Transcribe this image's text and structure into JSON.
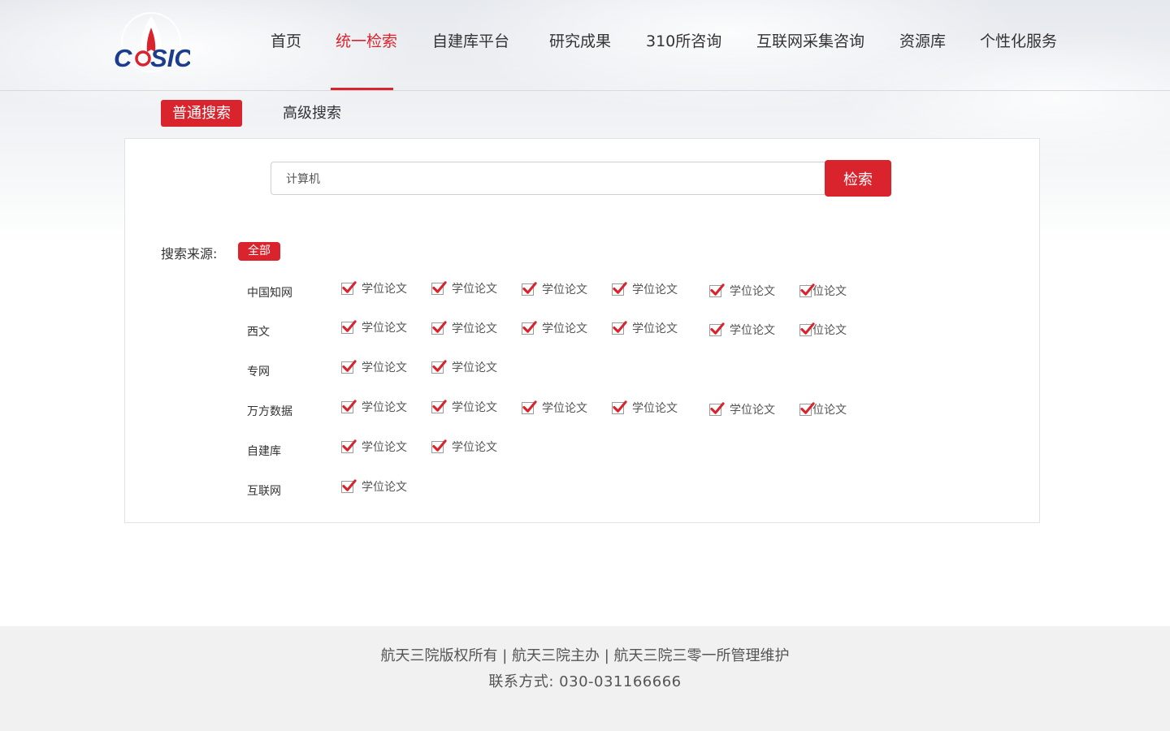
{
  "brand": {
    "logo_text": "CASIC",
    "accent_color": "#d9232d"
  },
  "nav": {
    "items": [
      {
        "label": "首页",
        "active": false
      },
      {
        "label": "统一检索",
        "active": true
      },
      {
        "label": "自建库平台",
        "active": false
      },
      {
        "label": "研究成果",
        "active": false
      },
      {
        "label": "310所咨询",
        "active": false
      },
      {
        "label": "互联网采集咨询",
        "active": false
      },
      {
        "label": "资源库",
        "active": false
      },
      {
        "label": "个性化服务",
        "active": false
      }
    ]
  },
  "tabs": {
    "basic": "普通搜索",
    "advanced": "高级搜索"
  },
  "search": {
    "value": "计算机",
    "button": "检索"
  },
  "sources": {
    "label": "搜索来源:",
    "all_label": "全部",
    "rows": [
      {
        "label": "中国知网",
        "options": [
          "学位论文",
          "学位论文",
          "学位论文",
          "学位论文",
          "学位论文",
          "学位论文"
        ]
      },
      {
        "label": "西文",
        "options": [
          "学位论文",
          "学位论文",
          "学位论文",
          "学位论文",
          "学位论文",
          "学位论文"
        ]
      },
      {
        "label": "专网",
        "options": [
          "学位论文",
          "学位论文"
        ]
      },
      {
        "label": "万方数据",
        "options": [
          "学位论文",
          "学位论文",
          "学位论文",
          "学位论文",
          "学位论文",
          "学位论文"
        ]
      },
      {
        "label": "自建库",
        "options": [
          "学位论文",
          "学位论文"
        ]
      },
      {
        "label": "互联网",
        "options": [
          "学位论文"
        ]
      }
    ]
  },
  "footer": {
    "line1": "航天三院版权所有 | 航天三院主办  |  航天三院三零一所管理维护",
    "line2": "联系方式: 030-031166666"
  }
}
